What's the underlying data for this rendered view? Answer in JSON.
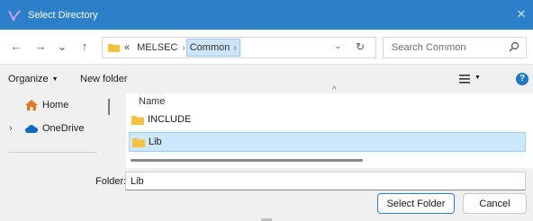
{
  "window": {
    "title": "Select Directory",
    "close_label": "✕"
  },
  "nav": {
    "back": "←",
    "forward": "→",
    "recent": "⌄",
    "up": "↑",
    "breadcrumb": {
      "overflow": "«",
      "items": [
        "MELSEC",
        "Common"
      ]
    },
    "address_dropdown": "⌄",
    "refresh": "↻"
  },
  "search": {
    "placeholder": "Search Common"
  },
  "toolbar": {
    "organize": "Organize",
    "new_folder": "New folder"
  },
  "sidebar": {
    "items": [
      {
        "label": "Home",
        "icon": "home-icon"
      },
      {
        "label": "OneDrive",
        "icon": "cloud-icon",
        "expandable": true
      }
    ]
  },
  "filelist": {
    "column": "Name",
    "rows": [
      {
        "name": "INCLUDE",
        "selected": false
      },
      {
        "name": "Lib",
        "selected": true
      }
    ]
  },
  "bottom": {
    "folder_label": "Folder:",
    "folder_value": "Lib",
    "select_button": "Select Folder",
    "cancel_button": "Cancel"
  },
  "colors": {
    "titlebar": "#2b80c9",
    "selection": "#cce8ff",
    "folder": "#f6c13f",
    "accent": "#1e78c8"
  }
}
